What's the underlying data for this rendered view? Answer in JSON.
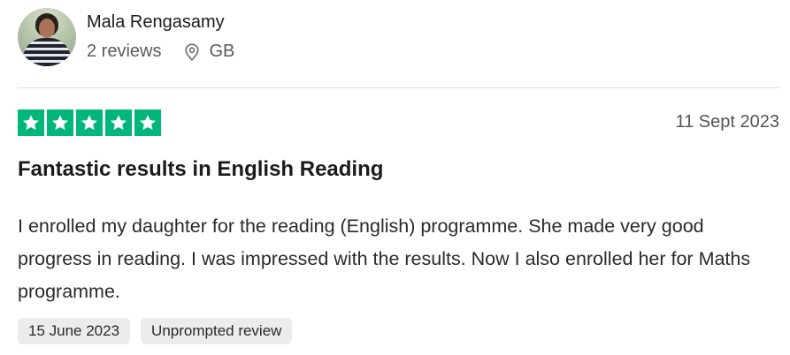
{
  "reviewer": {
    "name": "Mala Rengasamy",
    "reviews": "2 reviews",
    "location": "GB"
  },
  "review": {
    "rating": 5,
    "rating_max": 5,
    "date": "11 Sept 2023",
    "title": "Fantastic results in English Reading",
    "text": "I enrolled my daughter for the reading (English) programme. She made very good progress in reading. I was impressed with the results. Now I also enrolled her for Maths programme.",
    "tags": {
      "date_of_experience": "15 June 2023",
      "type": "Unprompted review"
    }
  },
  "colors": {
    "star_green": "#00b67a"
  },
  "icons": {
    "location": "map-pin-icon",
    "star": "star-icon"
  }
}
